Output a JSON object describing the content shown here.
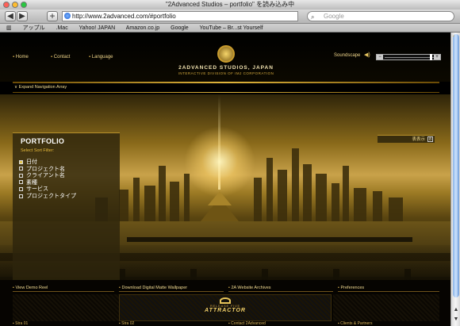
{
  "browser": {
    "window_title": "\"2Advanced Studios – portfolio\" を読み込み中",
    "url": "http://www.2advanced.com/#portfolio",
    "search_placeholder": "Google",
    "back": "◀",
    "forward": "▶",
    "add": "+",
    "bookmarks": [
      "アップル",
      ".Mac",
      "Yahoo! JAPAN",
      "Amazon.co.jp",
      "Google",
      "YouTube – Br...st Yourself"
    ]
  },
  "header": {
    "nav": {
      "home": "Home",
      "contact": "Contact",
      "language": "Language"
    },
    "brand_name": "2ADVANCED STUDIOS, JAPAN",
    "brand_tagline": "INTERACTIVE DIVISION OF IMJ CORPORATION",
    "soundscape_label": "Soundscape",
    "volume_minus": "−",
    "volume_plus": "+",
    "expand_label": "Expand Navigation Array",
    "volume_level": 0.95
  },
  "portfolio": {
    "title": "PORTFOLIO",
    "subtitle": "Select Sort Filter:",
    "filters": [
      {
        "label": "日付",
        "checked": true
      },
      {
        "label": "プロジェクト名",
        "checked": false
      },
      {
        "label": "クライアント名",
        "checked": false
      },
      {
        "label": "素種",
        "checked": false
      },
      {
        "label": "サービス",
        "checked": false
      },
      {
        "label": "プロジェクトタイプ",
        "checked": false
      }
    ],
    "view_label": "表表示",
    "view_count": "8"
  },
  "bottom": {
    "links": [
      "View Demo Reel",
      "Download Digital Matte Wallpaper",
      "2A Website Archives",
      "Preferences"
    ],
    "promo_line1": "RELEASE FIVE",
    "promo_line2": "ATTRACTOR",
    "thumbs": [
      "Stra 01",
      "Stra 02",
      "Contact 2Advanced",
      "Clients & Partners"
    ]
  }
}
